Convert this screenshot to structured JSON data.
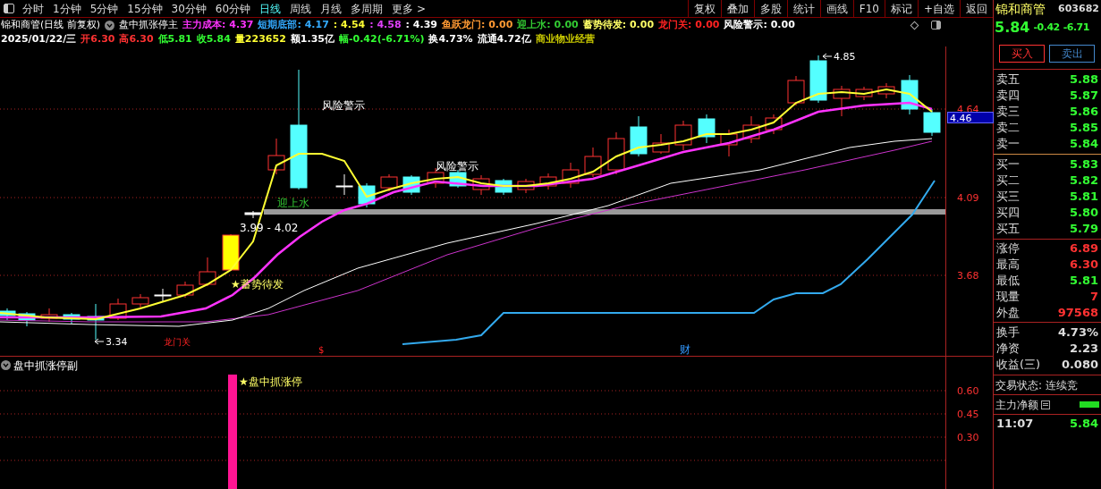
{
  "toolbar": {
    "periods": [
      {
        "label": "分时",
        "selected": false
      },
      {
        "label": "1分钟",
        "selected": false
      },
      {
        "label": "5分钟",
        "selected": false
      },
      {
        "label": "15分钟",
        "selected": false
      },
      {
        "label": "30分钟",
        "selected": false
      },
      {
        "label": "60分钟",
        "selected": false
      },
      {
        "label": "日线",
        "selected": true
      },
      {
        "label": "周线",
        "selected": false
      },
      {
        "label": "月线",
        "selected": false
      },
      {
        "label": "多周期",
        "selected": false
      },
      {
        "label": "更多 >",
        "selected": false
      }
    ],
    "buttons": [
      "复权",
      "叠加",
      "多股",
      "统计",
      "画线",
      "F10",
      "标记",
      "+自选",
      "返回"
    ]
  },
  "indicator_bar": {
    "title": "锦和商管(日线 前复权)",
    "formula": "盘中抓张停主",
    "values": [
      {
        "text": "主力成本: 4.37",
        "color": "#ff33ff"
      },
      {
        "text": "短期底部: 4.17",
        "color": "#33aaff"
      },
      {
        "text": ": 4.54",
        "color": "#ffff33"
      },
      {
        "text": ": 4.58",
        "color": "#e040fb"
      },
      {
        "text": ": 4.39",
        "color": "#ffffff"
      },
      {
        "text": "鱼跃龙门: 0.00",
        "color": "#ff9933"
      },
      {
        "text": "迎上水: 0.00",
        "color": "#33cc33"
      },
      {
        "text": "蓄势待发: 0.00",
        "color": "#ffff66"
      },
      {
        "text": "龙门关: 0.00",
        "color": "#ff2222"
      },
      {
        "text": "风险警示: 0.00",
        "color": "#ffffff"
      }
    ]
  },
  "quote_bar": [
    {
      "text": "2025/01/22/三",
      "color": "#ffffff"
    },
    {
      "text": "开6.30",
      "color": "#ff3232"
    },
    {
      "text": "高6.30",
      "color": "#ff3232"
    },
    {
      "text": "低5.81",
      "color": "#33ff33"
    },
    {
      "text": "收5.84",
      "color": "#33ff33"
    },
    {
      "text": "量223652",
      "color": "#ffff33"
    },
    {
      "text": "额1.35亿",
      "color": "#ffffff"
    },
    {
      "text": "幅-0.42(-6.71%)",
      "color": "#33ff33"
    },
    {
      "text": "换4.73%",
      "color": "#ffffff"
    },
    {
      "text": "流通4.72亿",
      "color": "#ffffff"
    },
    {
      "text": "商业物业经营",
      "color": "#cccc00"
    }
  ],
  "chart_annotations": [
    {
      "text": "风险警示",
      "kind": "label"
    },
    {
      "text": "风险警示",
      "kind": "label"
    },
    {
      "text": "4.85",
      "kind": "high"
    },
    {
      "text": "迎上水",
      "kind": "signal"
    },
    {
      "text": "3.99 - 4.02",
      "kind": "label"
    },
    {
      "text": "★蓄势待发",
      "kind": "star"
    },
    {
      "text": "3.34",
      "kind": "low"
    },
    {
      "text": "龙门关",
      "kind": "warning"
    },
    {
      "text": "$",
      "kind": "warning"
    },
    {
      "text": "财",
      "kind": "finance"
    }
  ],
  "axis": {
    "main_ticks": [
      "4.64",
      "4.09",
      "3.68"
    ],
    "price_tag": "4.46",
    "sub_ticks": [
      "0.60",
      "0.45",
      "0.30"
    ]
  },
  "sub_pane": {
    "title": "盘中抓涨停副",
    "signal": "★盘中抓涨停"
  },
  "quote_panel": {
    "name": "锦和商管",
    "code": "603682",
    "price": "5.84",
    "change": "-0.42",
    "change_pct": "-6.71",
    "rising": false,
    "buttons": [
      {
        "label": "买入",
        "kind": "buy"
      },
      {
        "label": "卖出",
        "kind": "sell"
      }
    ],
    "asks": [
      {
        "label": "卖五",
        "value": "5.88",
        "rising": false
      },
      {
        "label": "卖四",
        "value": "5.87",
        "rising": false
      },
      {
        "label": "卖三",
        "value": "5.86",
        "rising": false
      },
      {
        "label": "卖二",
        "value": "5.85",
        "rising": false
      },
      {
        "label": "卖一",
        "value": "5.84",
        "rising": false
      }
    ],
    "bids": [
      {
        "label": "买一",
        "value": "5.83",
        "rising": false
      },
      {
        "label": "买二",
        "value": "5.82",
        "rising": false
      },
      {
        "label": "买三",
        "value": "5.81",
        "rising": false
      },
      {
        "label": "买四",
        "value": "5.80",
        "rising": false
      },
      {
        "label": "买五",
        "value": "5.79",
        "rising": false
      }
    ],
    "stats": [
      {
        "label": "涨停",
        "value": "6.89",
        "rising": true
      },
      {
        "label": "最高",
        "value": "6.30",
        "rising": true
      },
      {
        "label": "最低",
        "value": "5.81",
        "rising": false
      },
      {
        "label": "现量",
        "value": "7",
        "rising": true
      },
      {
        "label": "外盘",
        "value": "97568",
        "rising": true
      }
    ],
    "fundamentals": [
      {
        "label": "换手",
        "value": "4.73%"
      },
      {
        "label": "净资",
        "value": "2.23"
      },
      {
        "label": "收益(三)",
        "value": "0.080"
      }
    ],
    "trade_status": "交易状态: 连续竞",
    "main_net": {
      "label": "主力净额",
      "rising": false
    },
    "tick": {
      "time": "11:07",
      "price": "5.84",
      "rising": false
    }
  }
}
